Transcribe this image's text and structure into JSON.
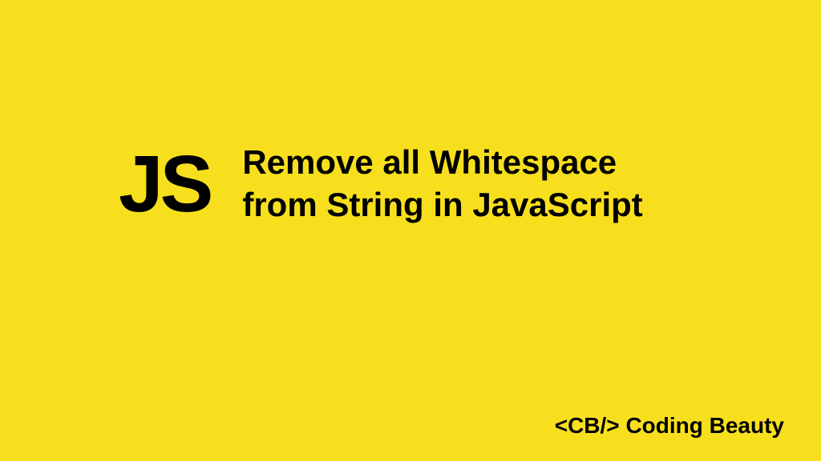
{
  "logo": "JS",
  "title_line1": "Remove all Whitespace",
  "title_line2": "from String in JavaScript",
  "footer": "<CB/> Coding Beauty",
  "colors": {
    "background": "#f7df1e",
    "text": "#000000"
  }
}
